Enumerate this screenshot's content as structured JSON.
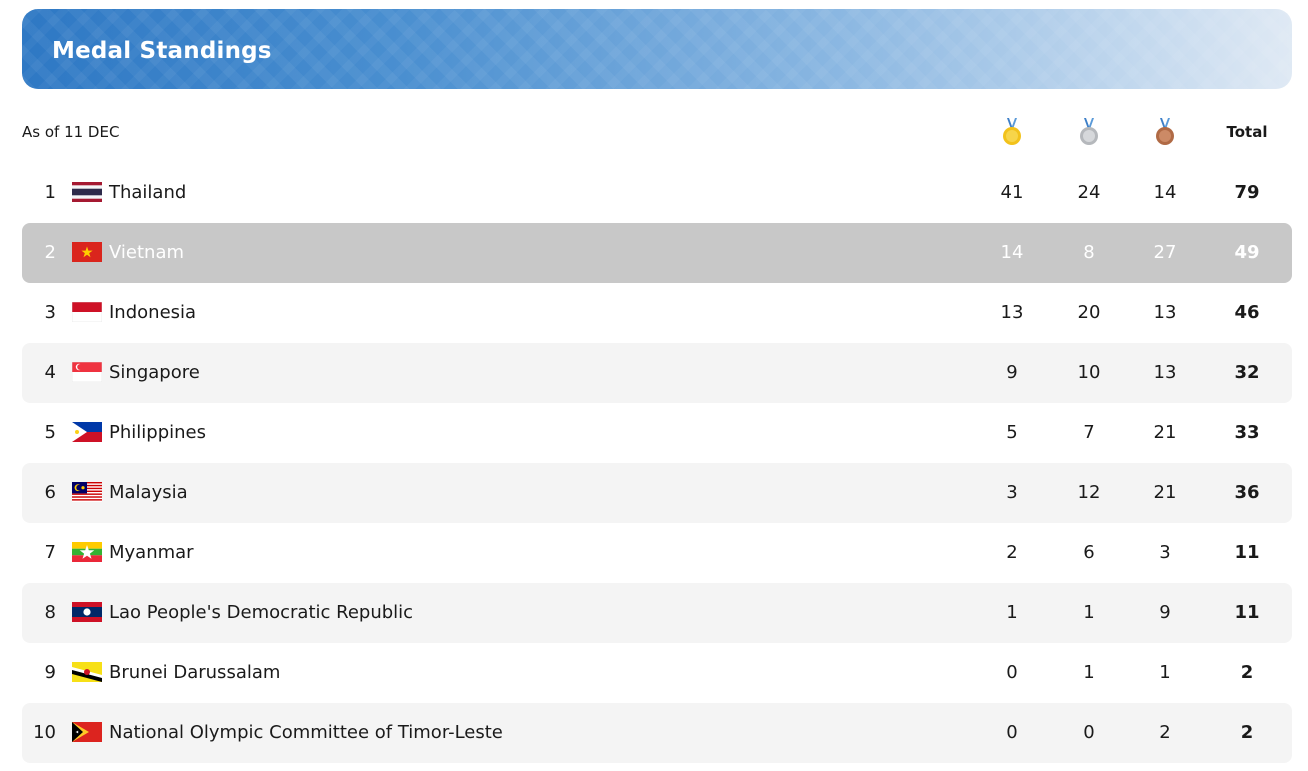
{
  "header": {
    "title": "Medal Standings"
  },
  "table": {
    "as_of": "As of 11 DEC",
    "total_label": "Total",
    "medal_icons": [
      "gold-medal-icon",
      "silver-medal-icon",
      "bronze-medal-icon"
    ],
    "selected_rank": "2",
    "rows": [
      {
        "rank": "1",
        "flag": "thailand-flag-icon",
        "country": "Thailand",
        "gold": "41",
        "silver": "24",
        "bronze": "14",
        "total": "79"
      },
      {
        "rank": "2",
        "flag": "vietnam-flag-icon",
        "country": "Vietnam",
        "gold": "14",
        "silver": "8",
        "bronze": "27",
        "total": "49"
      },
      {
        "rank": "3",
        "flag": "indonesia-flag-icon",
        "country": "Indonesia",
        "gold": "13",
        "silver": "20",
        "bronze": "13",
        "total": "46"
      },
      {
        "rank": "4",
        "flag": "singapore-flag-icon",
        "country": "Singapore",
        "gold": "9",
        "silver": "10",
        "bronze": "13",
        "total": "32"
      },
      {
        "rank": "5",
        "flag": "philippines-flag-icon",
        "country": "Philippines",
        "gold": "5",
        "silver": "7",
        "bronze": "21",
        "total": "33"
      },
      {
        "rank": "6",
        "flag": "malaysia-flag-icon",
        "country": "Malaysia",
        "gold": "3",
        "silver": "12",
        "bronze": "21",
        "total": "36"
      },
      {
        "rank": "7",
        "flag": "myanmar-flag-icon",
        "country": "Myanmar",
        "gold": "2",
        "silver": "6",
        "bronze": "3",
        "total": "11"
      },
      {
        "rank": "8",
        "flag": "laos-flag-icon",
        "country": "Lao People's Democratic Republic",
        "gold": "1",
        "silver": "1",
        "bronze": "9",
        "total": "11"
      },
      {
        "rank": "9",
        "flag": "brunei-flag-icon",
        "country": "Brunei Darussalam",
        "gold": "0",
        "silver": "1",
        "bronze": "1",
        "total": "2"
      },
      {
        "rank": "10",
        "flag": "timor-leste-flag-icon",
        "country": "National Olympic Committee of Timor-Leste",
        "gold": "0",
        "silver": "0",
        "bronze": "2",
        "total": "2"
      }
    ]
  },
  "colors": {
    "banner_start": "#2e78c4",
    "banner_end": "#dfe9f4",
    "row_alt": "#f4f4f4",
    "row_selected": "#c8c8c8",
    "gold": "#f2c21b",
    "silver": "#c4c7cb",
    "bronze": "#c07a55"
  }
}
